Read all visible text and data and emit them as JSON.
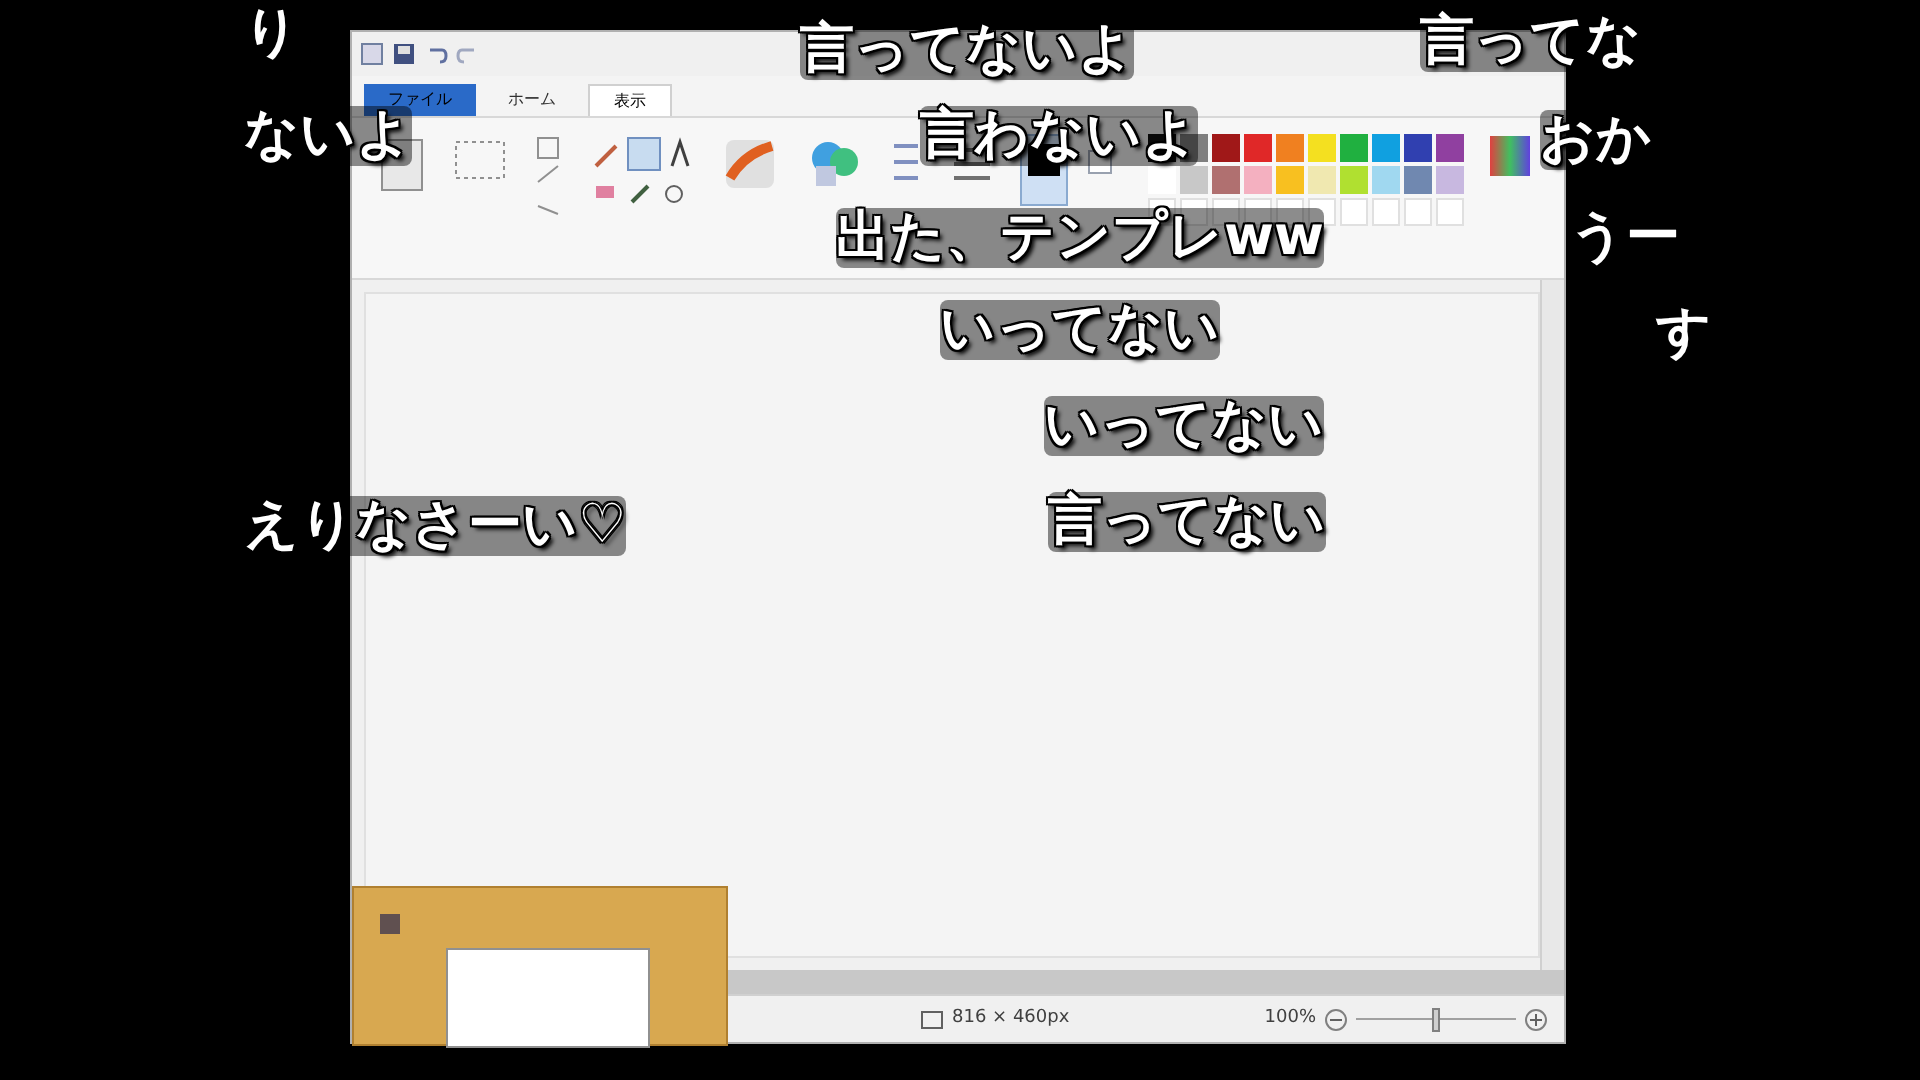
{
  "paint_window": {
    "tabs": [
      {
        "label": "ファイル",
        "selected": false,
        "kind": "file"
      },
      {
        "label": "ホーム",
        "selected": false,
        "kind": "tab"
      },
      {
        "label": "表示",
        "selected": true,
        "kind": "tab"
      }
    ],
    "palette": [
      {
        "color": "#111111"
      },
      {
        "color": "#7f7f7f"
      },
      {
        "color": "#a01818"
      },
      {
        "color": "#e02828"
      },
      {
        "color": "#f08020"
      },
      {
        "color": "#f4e020"
      },
      {
        "color": "#20b040"
      },
      {
        "color": "#10a0e0"
      },
      {
        "color": "#3040b0"
      },
      {
        "color": "#9040a0"
      },
      {
        "color": "#ffffff"
      },
      {
        "color": "#c8c8c8"
      },
      {
        "color": "#b07070"
      },
      {
        "color": "#f4b0c0"
      },
      {
        "color": "#f8c020"
      },
      {
        "color": "#f0e8b0"
      },
      {
        "color": "#b0e030"
      },
      {
        "color": "#a0d8f0"
      },
      {
        "color": "#7088b0"
      },
      {
        "color": "#c8b8e0"
      }
    ],
    "status_bar": {
      "size": "816 × 460px",
      "zoom": "100%",
      "zoom_slider": {
        "level": 0.5
      }
    }
  },
  "comments": [
    {
      "text": "り"
    },
    {
      "text": "言ってないよ"
    },
    {
      "text": "言ってな"
    },
    {
      "text": "ないよ"
    },
    {
      "text": "言わないよ"
    },
    {
      "text": "おか"
    },
    {
      "text": "出た、テンプレww"
    },
    {
      "text": "うー"
    },
    {
      "text": "す"
    },
    {
      "text": "いってない"
    },
    {
      "text": "いってない"
    },
    {
      "text": "えりなさーい♡"
    },
    {
      "text": "言ってない"
    }
  ]
}
